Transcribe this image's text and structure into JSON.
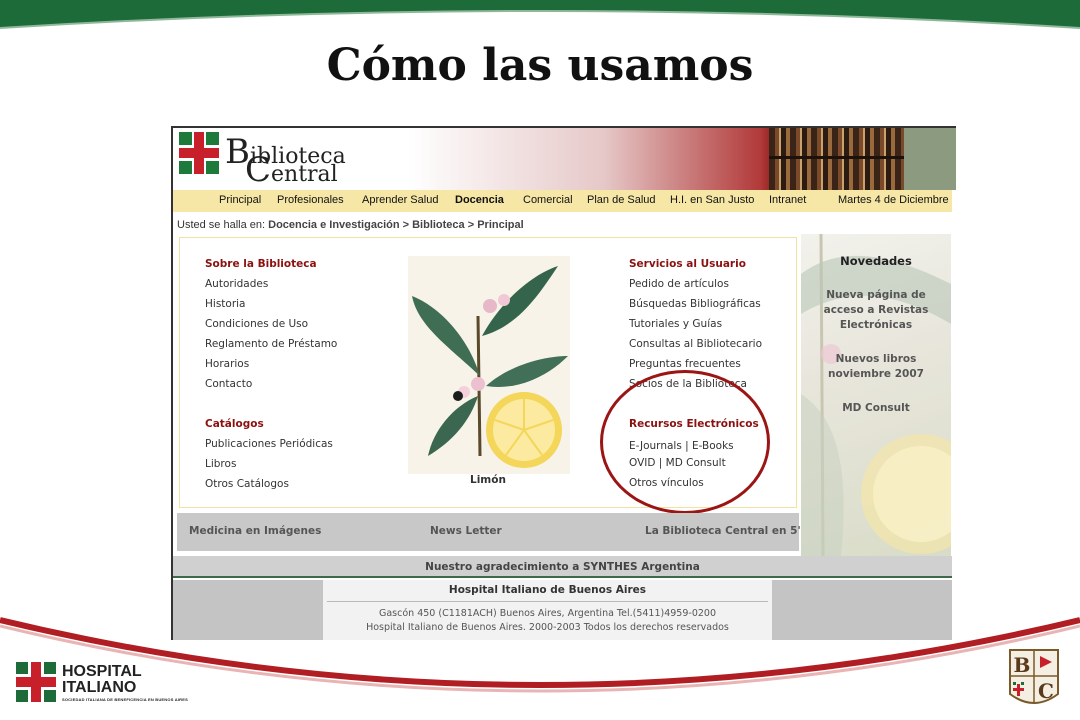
{
  "slide": {
    "title": "Cómo las usamos",
    "hospital_logo": {
      "line1": "HOSPITAL",
      "line2": "ITALIANO",
      "line3": "SOCIEDAD ITALIANA DE BENEFICENCIA EN BUENOS AIRES"
    },
    "bc_logo": {
      "letter1": "B",
      "letter2": "C"
    },
    "colors": {
      "green": "#1e6b3a",
      "red": "#b01e23"
    }
  },
  "site": {
    "logo": {
      "first_b": "B",
      "line1": "iblioteca",
      "first_c": "C",
      "line2": "entral"
    },
    "nav": [
      {
        "label": "Principal",
        "active": false
      },
      {
        "label": "Profesionales",
        "active": false
      },
      {
        "label": "Aprender Salud",
        "active": false
      },
      {
        "label": "Docencia",
        "active": true
      },
      {
        "label": "Comercial",
        "active": false
      },
      {
        "label": "Plan de Salud",
        "active": false
      },
      {
        "label": "H.I. en San Justo",
        "active": false
      },
      {
        "label": "Intranet",
        "active": false
      }
    ],
    "date": "Martes 4 de Diciembre",
    "breadcrumb": {
      "prefix": "Usted se halla en:",
      "path": "Docencia e Investigación > Biblioteca > Principal"
    },
    "left_col": {
      "section1": {
        "heading": "Sobre la Biblioteca",
        "links": [
          "Autoridades",
          "Historia",
          "Condiciones de Uso",
          "Reglamento de Préstamo",
          "Horarios",
          "Contacto"
        ]
      },
      "section2": {
        "heading": "Catálogos",
        "links": [
          "Publicaciones Periódicas",
          "Libros",
          "Otros Catálogos"
        ]
      }
    },
    "image_caption": "Limón",
    "right_col": {
      "section1": {
        "heading": "Servicios al Usuario",
        "links": [
          "Pedido de artículos",
          "Búsquedas Bibliográficas",
          "Tutoriales y Guías",
          "Consultas al Bibliotecario",
          "Preguntas frecuentes",
          "Socios de la Biblioteca"
        ]
      },
      "section2": {
        "heading": "Recursos Electrónicos",
        "links": [
          "E-Journals | E-Books",
          "OVID | MD Consult",
          "Otros vínculos"
        ]
      }
    },
    "bottom_links": [
      "Medicina en Imágenes",
      "News Letter",
      "La Biblioteca Central en 5'"
    ],
    "novedades": {
      "title": "Novedades",
      "items": [
        "Nueva página de acceso a Revistas Electrónicas",
        "Nuevos libros noviembre 2007",
        "MD Consult"
      ]
    },
    "thanks": "Nuestro agradecimiento a SYNTHES Argentina",
    "footer": {
      "title": "Hospital Italiano de Buenos Aires",
      "address": "Gascón 450 (C1181ACH) Buenos Aires, Argentina Tel.(5411)4959-0200",
      "copyright": "Hospital Italiano de Buenos Aires. 2000-2003 Todos los derechos reservados"
    }
  }
}
